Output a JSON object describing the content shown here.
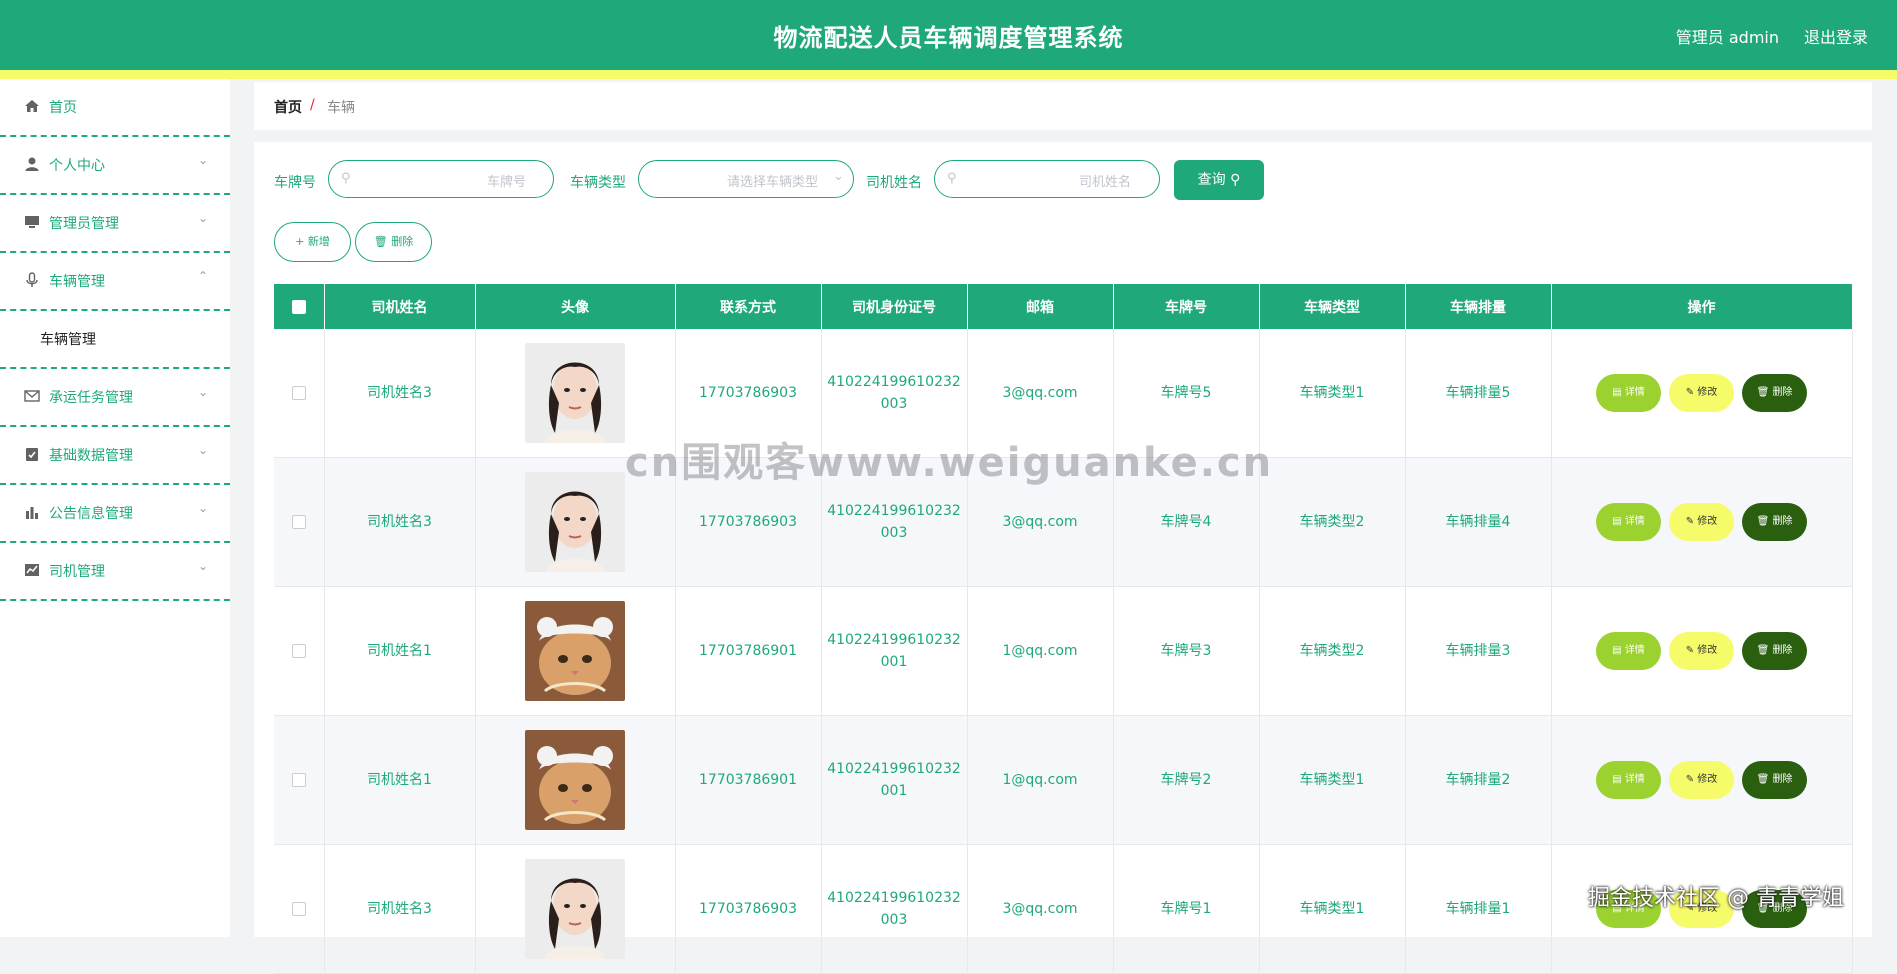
{
  "header": {
    "title": "物流配送人员车辆调度管理系统",
    "user_info": "管理员 admin",
    "logout": "退出登录",
    "bg_color": "#1fa97a",
    "stripe_color": "#f6fb6a"
  },
  "sidebar": {
    "items": [
      {
        "label": "首页",
        "icon": "home-icon"
      },
      {
        "label": "个人中心",
        "icon": "user-icon"
      },
      {
        "label": "管理员管理",
        "icon": "monitor-icon"
      },
      {
        "label": "车辆管理",
        "icon": "microphone-icon"
      },
      {
        "label": "承运任务管理",
        "icon": "mail-icon"
      },
      {
        "label": "基础数据管理",
        "icon": "clipboard-check-icon"
      },
      {
        "label": "公告信息管理",
        "icon": "bar-chart-icon"
      },
      {
        "label": "司机管理",
        "icon": "line-chart-icon"
      }
    ],
    "submenu": {
      "label": "车辆管理"
    }
  },
  "breadcrumb": {
    "home": "首页",
    "separator": "/",
    "current": "车辆"
  },
  "search": {
    "plate_label": "车牌号",
    "plate_placeholder": "车牌号",
    "type_label": "车辆类型",
    "type_placeholder": "请选择车辆类型",
    "driver_label": "司机姓名",
    "driver_placeholder": "司机姓名",
    "query_button": "查询"
  },
  "actions": {
    "add": "新增",
    "delete": "删除"
  },
  "table": {
    "columns": [
      "司机姓名",
      "头像",
      "联系方式",
      "司机身份证号",
      "邮箱",
      "车牌号",
      "车辆类型",
      "车辆排量",
      "操作"
    ],
    "rows": [
      {
        "driver": "司机姓名3",
        "avatar": "woman-portrait",
        "phone": "17703786903",
        "id_line1": "410224199610232",
        "id_line2": "003",
        "email": "3@qq.com",
        "plate": "车牌号5",
        "type": "车辆类型1",
        "displacement": "车辆排量5"
      },
      {
        "driver": "司机姓名3",
        "avatar": "woman-portrait",
        "phone": "17703786903",
        "id_line1": "410224199610232",
        "id_line2": "003",
        "email": "3@qq.com",
        "plate": "车牌号4",
        "type": "车辆类型2",
        "displacement": "车辆排量4"
      },
      {
        "driver": "司机姓名1",
        "avatar": "cat-photo",
        "phone": "17703786901",
        "id_line1": "410224199610232",
        "id_line2": "001",
        "email": "1@qq.com",
        "plate": "车牌号3",
        "type": "车辆类型2",
        "displacement": "车辆排量3"
      },
      {
        "driver": "司机姓名1",
        "avatar": "cat-photo",
        "phone": "17703786901",
        "id_line1": "410224199610232",
        "id_line2": "001",
        "email": "1@qq.com",
        "plate": "车牌号2",
        "type": "车辆类型1",
        "displacement": "车辆排量2"
      },
      {
        "driver": "司机姓名3",
        "avatar": "woman-portrait",
        "phone": "17703786903",
        "id_line1": "410224199610232",
        "id_line2": "003",
        "email": "3@qq.com",
        "plate": "车牌号1",
        "type": "车辆类型1",
        "displacement": "车辆排量1"
      }
    ],
    "row_buttons": {
      "detail": "详情",
      "edit": "修改",
      "delete": "删除"
    }
  },
  "watermarks": {
    "center": "cn围观客www.weiguanke.cn",
    "corner": "掘金技术社区 @ 青青学姐"
  }
}
